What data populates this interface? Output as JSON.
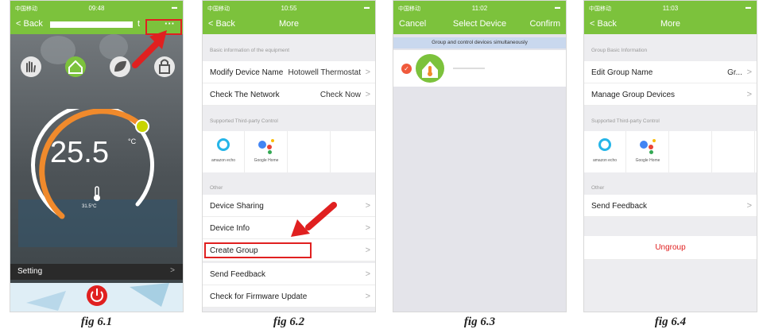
{
  "phone1": {
    "carrier": "中国移动",
    "time": "09:48",
    "back": "< Back",
    "title_suffix": "t",
    "more_label": "···",
    "temp": "25.5",
    "unit": "°C",
    "room_temp": "31.5°C",
    "setting": "Setting",
    "setting_chev": ">",
    "caption": "fig 6.1"
  },
  "phone2": {
    "carrier": "中国移动",
    "time": "10:55",
    "back": "< Back",
    "title": "More",
    "sec_basic": "Basic information of the equipment",
    "modify_label": "Modify Device Name",
    "modify_value": "Hotowell Thermostat",
    "network_label": "Check The Network",
    "network_value": "Check Now",
    "sec_third": "Supported Third-party Control",
    "echo_label": "amazon echo",
    "google_label": "Google Home",
    "sec_other": "Other",
    "items": [
      "Device Sharing",
      "Device Info",
      "Create Group",
      "Send Feedback",
      "Check for Firmware Update"
    ],
    "chev": ">",
    "caption": "fig 6.2"
  },
  "phone3": {
    "carrier": "中国移动",
    "time": "11:02",
    "cancel": "Cancel",
    "title": "Select Device",
    "confirm": "Confirm",
    "banner": "Group and control devices simultaneously",
    "check": "✓",
    "caption": "fig 6.3"
  },
  "phone4": {
    "carrier": "中国移动",
    "time": "11:03",
    "back": "< Back",
    "title": "More",
    "sec_basic": "Group Basic Information",
    "edit_label": "Edit Group Name",
    "edit_value": "Gr...",
    "manage_label": "Manage Group Devices",
    "sec_third": "Supported Third-party Control",
    "echo_label": "amazon echo",
    "google_label": "Google Home",
    "sec_other": "Other",
    "feedback": "Send Feedback",
    "ungroup": "Ungroup",
    "chev": ">",
    "caption": "fig 6.4"
  },
  "colors": {
    "green": "#7cc23c",
    "orange": "#f08a2c",
    "red": "#e02020",
    "banner": "#c9d8ee"
  },
  "icons": [
    "hand-icon",
    "home-icon",
    "leaf-icon",
    "lock-icon",
    "power-icon",
    "thermometer-icon",
    "arrow-icon"
  ]
}
